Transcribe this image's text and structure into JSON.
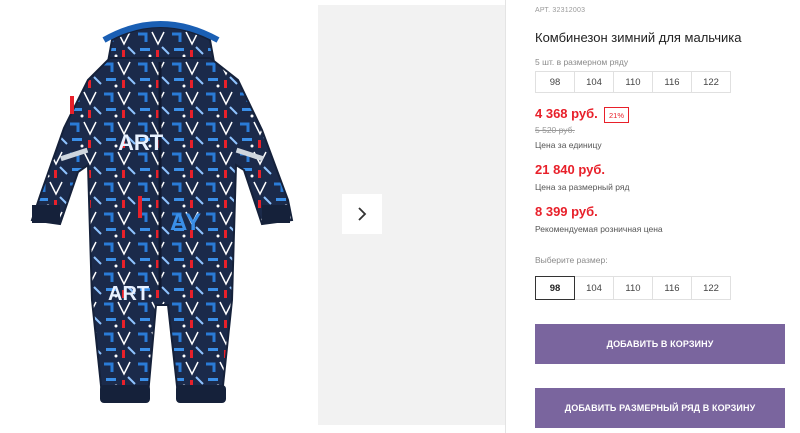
{
  "product": {
    "sku": "АРТ. 32312003",
    "title": "Комбинезон зимний для мальчика"
  },
  "pack": {
    "label": "5 шт. в размерном ряду",
    "sizes": [
      "98",
      "104",
      "110",
      "116",
      "122"
    ]
  },
  "prices": {
    "unit_price": "4 368 руб.",
    "discount_badge": "21%",
    "old_price": "5 520 руб.",
    "unit_caption": "Цена за единицу",
    "pack_price": "21 840 руб.",
    "pack_caption": "Цена за размерный ряд",
    "retail_price": "8 399 руб.",
    "retail_caption": "Рекомендуемая розничная цена"
  },
  "size_select": {
    "label": "Выберите размер:",
    "sizes": [
      "98",
      "104",
      "110",
      "116",
      "122"
    ],
    "selected": "98"
  },
  "buttons": {
    "add_to_cart": "ДОБАВИТЬ В КОРЗИНУ",
    "add_pack_to_cart": "ДОБАВИТЬ РАЗМЕРНЫЙ РЯД В КОРЗИНУ"
  },
  "colors": {
    "price_red": "#e8202a",
    "button_purple": "#7a659e",
    "garment_navy": "#1b2a4a",
    "garment_blue": "#2a7bd6"
  },
  "icons": {
    "next_arrow": "chevron-right-icon"
  }
}
